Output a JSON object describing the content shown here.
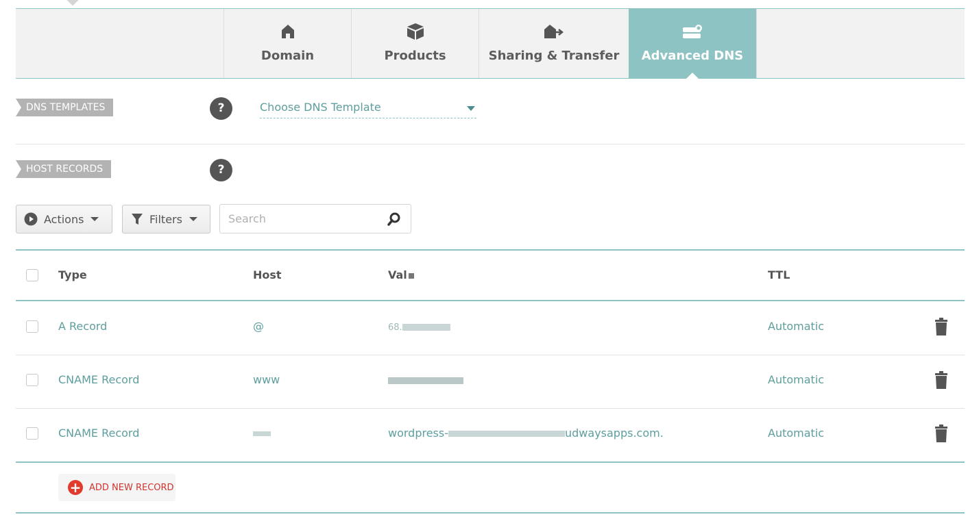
{
  "tabs": [
    {
      "label": "Domain",
      "icon": "home-icon",
      "active": false
    },
    {
      "label": "Products",
      "icon": "box-icon",
      "active": false
    },
    {
      "label": "Sharing & Transfer",
      "icon": "transfer-icon",
      "active": false
    },
    {
      "label": "Advanced DNS",
      "icon": "server-icon",
      "active": true
    }
  ],
  "dns_templates": {
    "label": "DNS TEMPLATES",
    "help": "?",
    "select_value": "Choose DNS Template"
  },
  "host_records": {
    "label": "HOST RECORDS",
    "help": "?"
  },
  "toolbar": {
    "actions_label": "Actions",
    "filters_label": "Filters",
    "search_placeholder": "Search"
  },
  "table": {
    "columns": [
      "Type",
      "Host",
      "Val",
      "TTL"
    ],
    "rows": [
      {
        "type": "A Record",
        "host": "@",
        "value": "68.",
        "ttl": "Automatic"
      },
      {
        "type": "CNAME Record",
        "host": "www",
        "value": "",
        "ttl": "Automatic"
      },
      {
        "type": "CNAME Record",
        "host": "",
        "value_prefix": "wordpress-",
        "value_suffix": "udwaysapps.com.",
        "ttl": "Automatic"
      }
    ]
  },
  "add_record_label": "ADD NEW RECORD",
  "colors": {
    "accent": "#8ec3c3",
    "link_text": "#5e9e9e",
    "danger": "#e03b2c"
  }
}
